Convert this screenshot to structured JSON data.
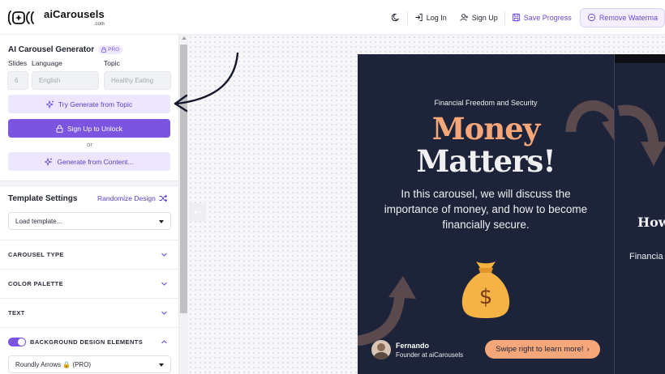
{
  "header": {
    "brand": "aiCarousels",
    "brand_sub": ".com",
    "login_label": "Log In",
    "signup_label": "Sign Up",
    "save_label": "Save Progress",
    "remove_watermark_label": "Remove Waterma"
  },
  "generator": {
    "title": "AI Carousel Generator",
    "pro_badge": "PRO",
    "slides_label": "Slides",
    "slides_value": "6",
    "language_label": "Language",
    "language_placeholder": "English",
    "topic_label": "Topic",
    "topic_placeholder": "Healthy Eating",
    "try_generate_label": "Try Generate from Topic",
    "signup_unlock_label": "Sign Up to Unlock",
    "or_label": "or",
    "generate_content_label": "Generate from Content..."
  },
  "template": {
    "title": "Template Settings",
    "randomize_label": "Randomize Design",
    "load_template_value": "Load template...",
    "sections": [
      "CAROUSEL TYPE",
      "COLOR PALETTE",
      "TEXT"
    ],
    "background_elements_label": "BACKGROUND DESIGN ELEMENTS",
    "background_elements_enabled": true,
    "background_select_value": "Roundly Arrows 🔒 (PRO)"
  },
  "slide": {
    "subtitle": "Financial Freedom and Security",
    "title_line1": "Money",
    "title_line2": "Matters!",
    "body": "In this carousel, we will discuss the importance of money, and how to become financially secure.",
    "author_name": "Fernando",
    "author_role": "Founder at aiCarousels",
    "swipe_label": "Swipe right to learn more!",
    "swipe_arrow": "›",
    "money_symbol": "$"
  },
  "slide_next": {
    "heading_partial": "How",
    "body_partial": "Financia"
  },
  "colors": {
    "accent": "#7b54e0",
    "slide_bg": "#1d2338",
    "highlight": "#f5a77a"
  }
}
